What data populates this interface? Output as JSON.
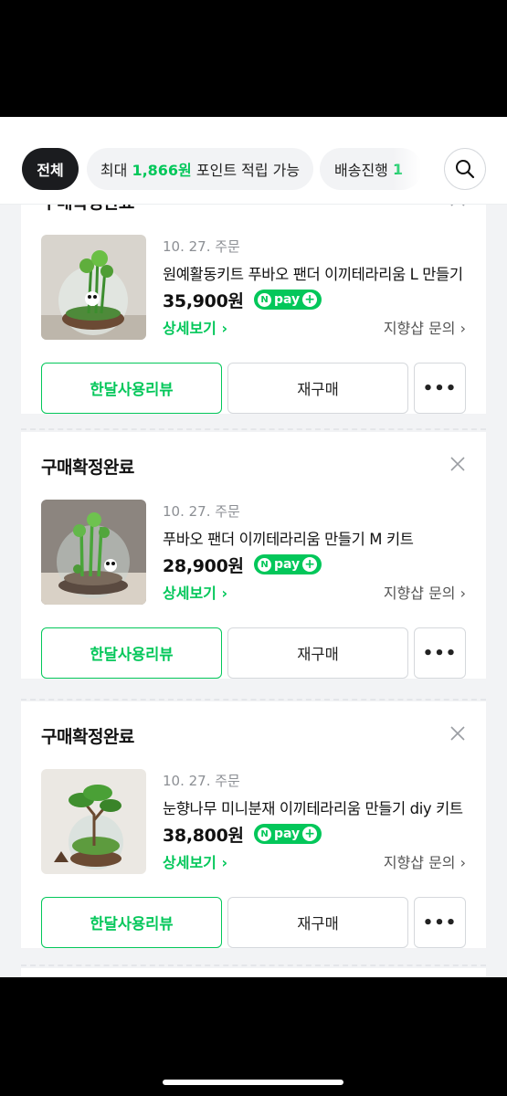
{
  "filters": {
    "all_label": "전체",
    "point_prefix": "최대 ",
    "point_amount": "1,866원",
    "point_suffix": " 포인트 적립 가능",
    "shipping_label": "배송진행 ",
    "shipping_count": "1"
  },
  "icons": {
    "search": "search-icon",
    "close": "close-icon",
    "chevron": "chevron-right-icon"
  },
  "colors": {
    "accent": "#03c75a",
    "chip_active": "#1b1c1f",
    "text": "#111111"
  },
  "orders": [
    {
      "status": "구매확정완료",
      "date": "10. 27. 주문",
      "name": "원예활동키트 푸바오 팬더 이끼테라리움 L 만들기",
      "price": "35,900원",
      "npay": "pay",
      "detail": "상세보기 ›",
      "inquiry": "지향샵 문의 ›",
      "review_button": "한달사용리뷰",
      "rebuy_button": "재구매",
      "more_button": "•••"
    },
    {
      "status": "구매확정완료",
      "date": "10. 27. 주문",
      "name": "푸바오 팬더 이끼테라리움 만들기 M 키트",
      "price": "28,900원",
      "npay": "pay",
      "detail": "상세보기 ›",
      "inquiry": "지향샵 문의 ›",
      "review_button": "한달사용리뷰",
      "rebuy_button": "재구매",
      "more_button": "•••"
    },
    {
      "status": "구매확정완료",
      "date": "10. 27. 주문",
      "name": "눈향나무 미니분재 이끼테라리움 만들기 diy 키트",
      "price": "38,800원",
      "npay": "pay",
      "detail": "상세보기 ›",
      "inquiry": "지향샵 문의 ›",
      "review_button": "한달사용리뷰",
      "rebuy_button": "재구매",
      "more_button": "•••"
    }
  ]
}
